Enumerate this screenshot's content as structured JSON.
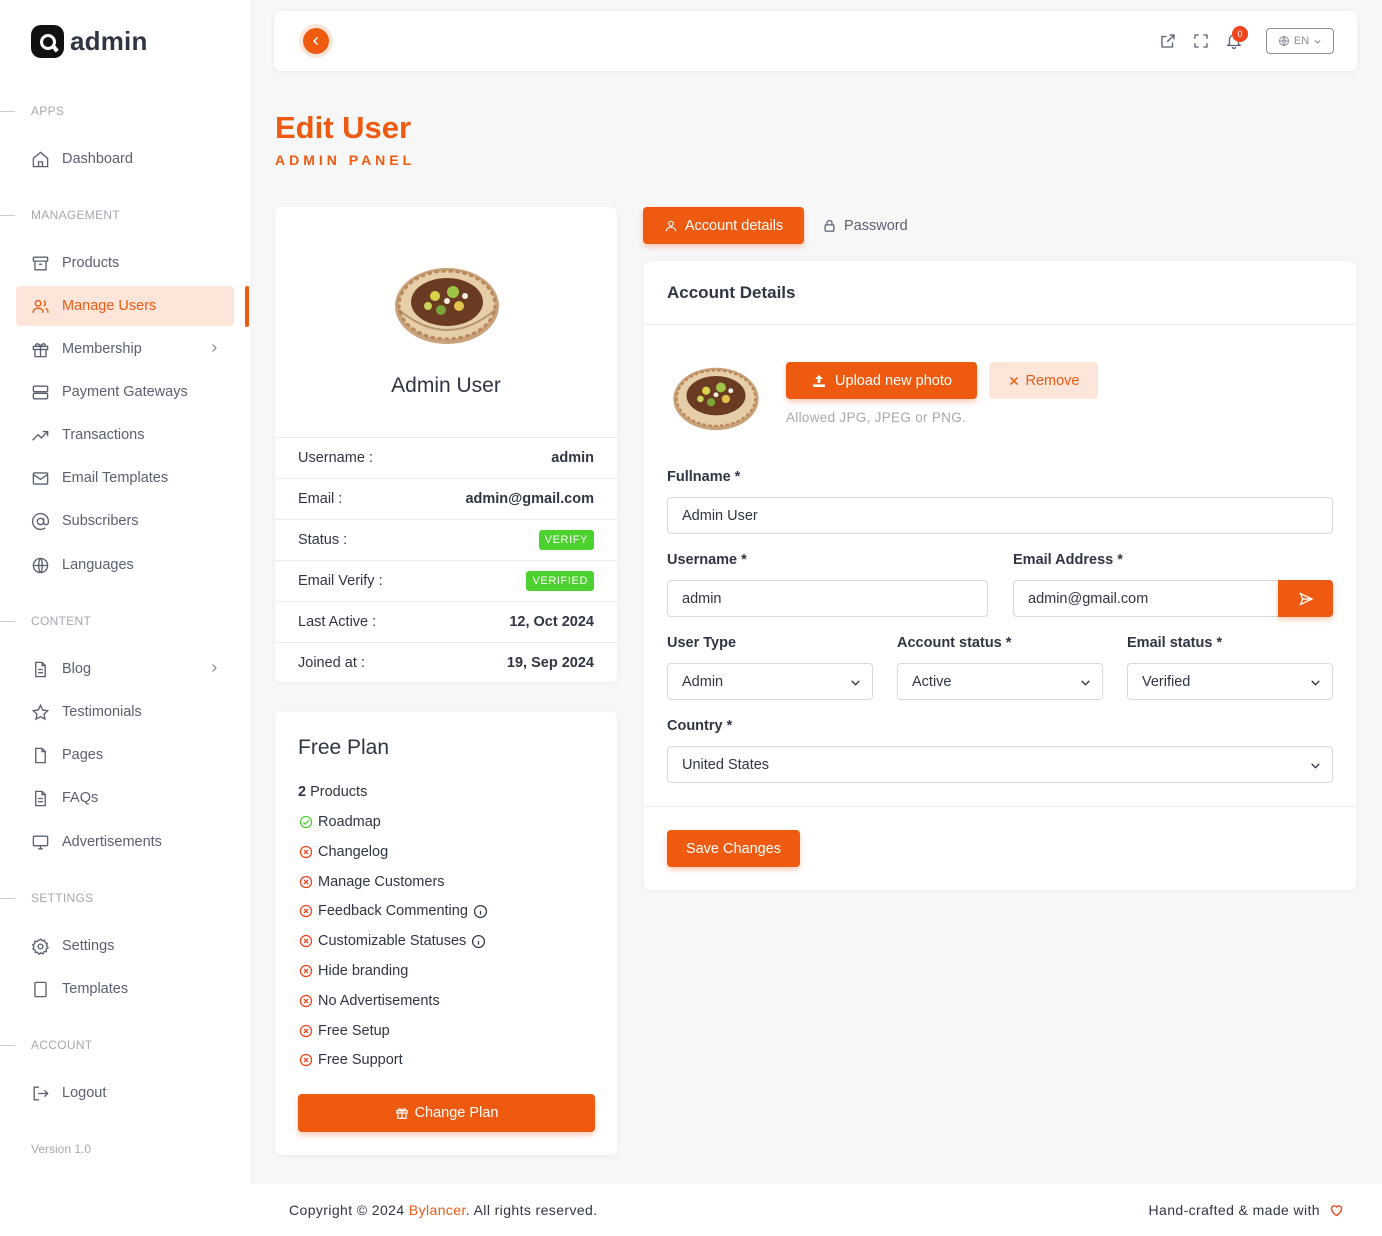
{
  "brand": {
    "name": "admin",
    "accent": "#ef5a11"
  },
  "sidebar": {
    "sections": {
      "apps": "APPS",
      "management": "MANAGEMENT",
      "content": "CONTENT",
      "settings": "SETTINGS",
      "account": "ACCOUNT"
    },
    "items": {
      "dashboard": "Dashboard",
      "products": "Products",
      "manage_users": "Manage Users",
      "membership": "Membership",
      "payment_gateways": "Payment Gateways",
      "transactions": "Transactions",
      "email_templates": "Email Templates",
      "subscribers": "Subscribers",
      "languages": "Languages",
      "blog": "Blog",
      "testimonials": "Testimonials",
      "pages": "Pages",
      "faqs": "FAQs",
      "advertisements": "Advertisements",
      "settings": "Settings",
      "templates": "Templates",
      "logout": "Logout"
    },
    "active_item": "manage_users",
    "version": "Version 1.0"
  },
  "topbar": {
    "notification_count": "0",
    "language": "EN"
  },
  "page": {
    "title": "Edit User",
    "subtitle": "ADMIN PANEL"
  },
  "profile": {
    "name": "Admin User",
    "rows": {
      "username_label": "Username :",
      "username_value": "admin",
      "email_label": "Email :",
      "email_value": "admin@gmail.com",
      "status_label": "Status :",
      "status_value": "VERIFY",
      "email_verify_label": "Email Verify :",
      "email_verify_value": "VERIFIED",
      "last_active_label": "Last Active :",
      "last_active_value": "12, Oct 2024",
      "joined_label": "Joined at :",
      "joined_value": "19, Sep 2024"
    }
  },
  "plan": {
    "title": "Free Plan",
    "products_count": "2",
    "products_label": " Products",
    "features": [
      {
        "label": "Roadmap",
        "included": true,
        "info": false
      },
      {
        "label": "Changelog",
        "included": false,
        "info": false
      },
      {
        "label": "Manage Customers",
        "included": false,
        "info": false
      },
      {
        "label": "Feedback Commenting",
        "included": false,
        "info": true
      },
      {
        "label": "Customizable Statuses",
        "included": false,
        "info": true
      },
      {
        "label": "Hide branding",
        "included": false,
        "info": false
      },
      {
        "label": "No Advertisements",
        "included": false,
        "info": false
      },
      {
        "label": "Free Setup",
        "included": false,
        "info": false
      },
      {
        "label": "Free Support",
        "included": false,
        "info": false
      }
    ],
    "change_plan_label": "Change Plan"
  },
  "tabs": {
    "account_details": "Account details",
    "password": "Password"
  },
  "account": {
    "title": "Account Details",
    "upload_label": "Upload new photo",
    "remove_label": "Remove",
    "allowed_text": "Allowed JPG, JPEG or PNG.",
    "fullname_label": "Fullname *",
    "fullname_value": "Admin User",
    "username_label": "Username *",
    "username_value": "admin",
    "email_label": "Email Address *",
    "email_value": "admin@gmail.com",
    "user_type_label": "User Type",
    "user_type_value": "Admin",
    "account_status_label": "Account status *",
    "account_status_value": "Active",
    "email_status_label": "Email status *",
    "email_status_value": "Verified",
    "country_label": "Country *",
    "country_value": "United States",
    "save_label": "Save Changes"
  },
  "footer": {
    "copyright_prefix": "Copyright © 2024 ",
    "company": "Bylancer",
    "copyright_suffix": ". All rights reserved.",
    "handcrafted": "Hand-crafted & made with"
  }
}
